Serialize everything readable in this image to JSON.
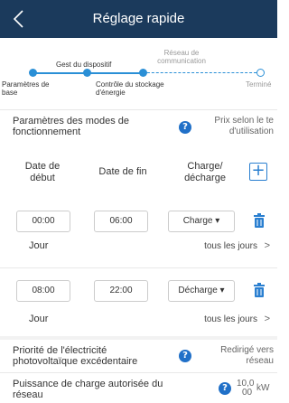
{
  "header": {
    "title": "Réglage rapide",
    "back_icon": "chevron-left-icon"
  },
  "steps": {
    "items": [
      {
        "label": "Paramètres de base",
        "state": "done"
      },
      {
        "label": "Gest du dispositif",
        "state": "done"
      },
      {
        "label": "Contrôle du stockage d'énergie",
        "state": "current"
      },
      {
        "label": "Réseau de communication",
        "state": "todo"
      },
      {
        "label": "Terminé",
        "state": "todo"
      }
    ]
  },
  "mode": {
    "label_line1": "Paramètres des modes de",
    "label_line2": "fonctionnement",
    "value_line1": "Prix selon le te",
    "value_line2": "d'utilisation"
  },
  "table": {
    "col_start_1": "Date de",
    "col_start_2": "début",
    "col_end": "Date de fin",
    "col_charge_1": "Charge/",
    "col_charge_2": "décharge",
    "add_icon": "plus-icon",
    "rows": [
      {
        "start": "00:00",
        "end": "06:00",
        "mode": "Charge ▾",
        "day_label": "Jour",
        "day_value": "tous les jours",
        "arrow": ">"
      },
      {
        "start": "08:00",
        "end": "22:00",
        "mode": "Décharge ▾",
        "day_label": "Jour",
        "day_value": "tous les jours",
        "arrow": ">"
      }
    ]
  },
  "pv": {
    "label_line1": "Priorité de l'électricité",
    "label_line2": "photovoltaïque excédentaire",
    "value_line1": "Redirigé vers",
    "value_line2": "réseau"
  },
  "grid": {
    "label_line1": "Puissance de charge autorisée du",
    "label_line2": "réseau",
    "value_top": "10,0",
    "value_bottom": "00",
    "unit": "kW"
  },
  "colors": {
    "header": "#1b3a5c",
    "accent": "#2a8fd6",
    "info": "#2070c8"
  }
}
